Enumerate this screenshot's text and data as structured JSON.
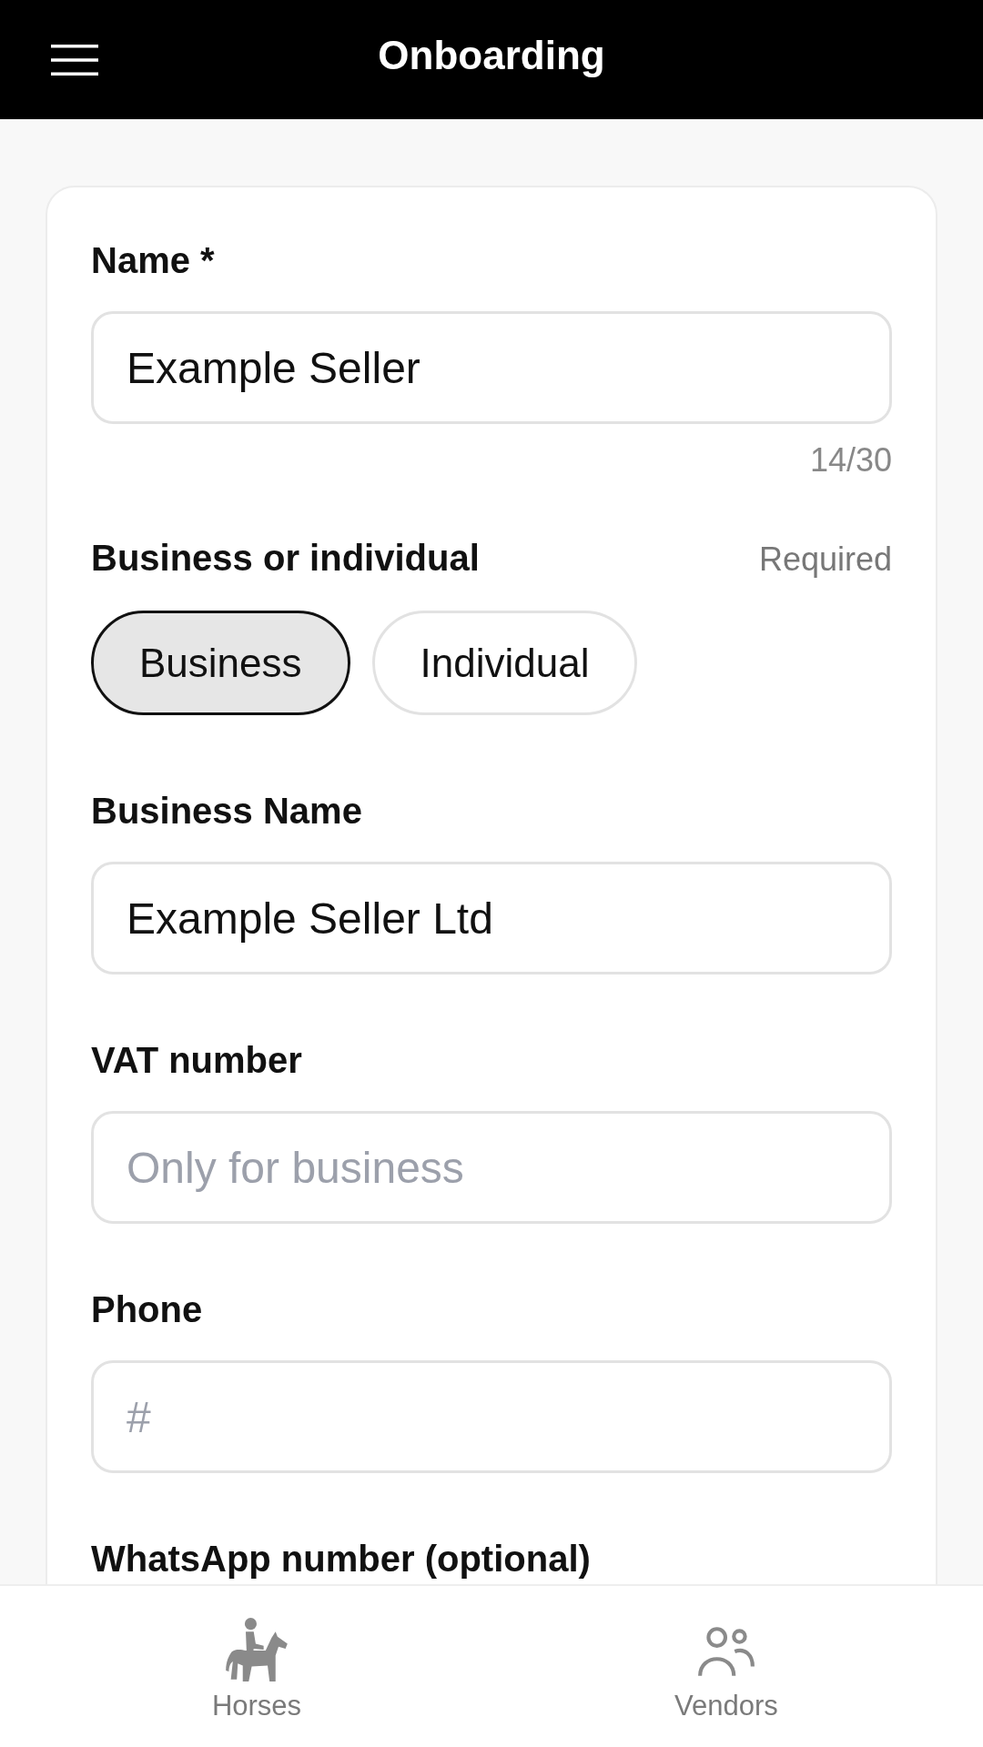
{
  "header": {
    "title": "Onboarding"
  },
  "form": {
    "fields": [
      {
        "kind": "text",
        "label": "Name *",
        "value": "Example Seller",
        "counter": "14/30"
      },
      {
        "kind": "choice",
        "label": "Business or individual",
        "hint": "Required",
        "options": [
          {
            "label": "Business",
            "selected": true
          },
          {
            "label": "Individual",
            "selected": false
          }
        ]
      },
      {
        "kind": "text",
        "label": "Business Name",
        "value": "Example Seller Ltd"
      },
      {
        "kind": "text",
        "label": "VAT number",
        "placeholder": "Only for business"
      },
      {
        "kind": "text",
        "label": "Phone",
        "placeholder": "#"
      },
      {
        "kind": "heading",
        "label": "WhatsApp number (optional)"
      }
    ]
  },
  "bottom_nav": {
    "items": [
      {
        "label": "Horses"
      },
      {
        "label": "Vendors"
      }
    ]
  }
}
